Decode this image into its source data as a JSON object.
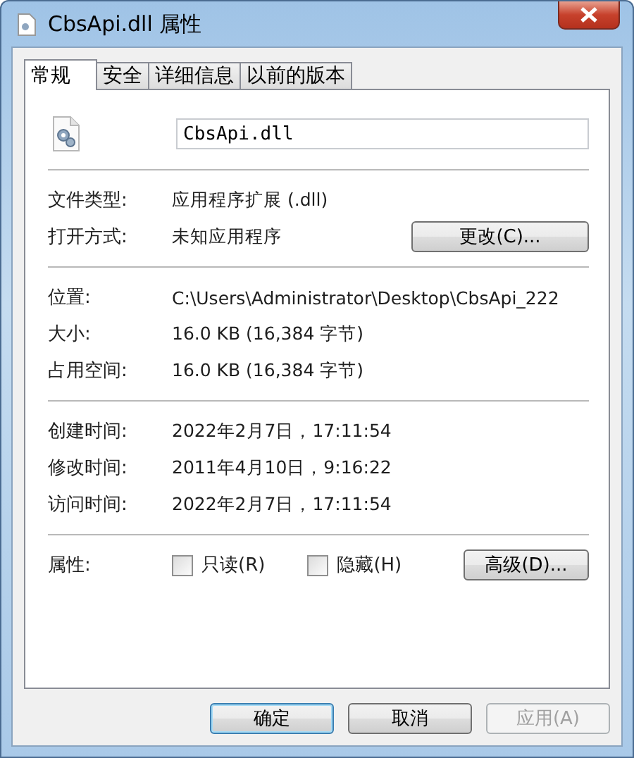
{
  "window": {
    "title": "CbsApi.dll 属性"
  },
  "tabs": [
    {
      "label": "常规",
      "selected": true
    },
    {
      "label": "安全",
      "selected": false
    },
    {
      "label": "详细信息",
      "selected": false
    },
    {
      "label": "以前的版本",
      "selected": false
    }
  ],
  "file_name": "CbsApi.dll",
  "groups": [
    {
      "rows": [
        {
          "label": "文件类型:",
          "value": "应用程序扩展 (.dll)"
        },
        {
          "label": "打开方式:",
          "value": "未知应用程序",
          "button": "更改(C)..."
        }
      ]
    },
    {
      "rows": [
        {
          "label": "位置:",
          "value": "C:\\Users\\Administrator\\Desktop\\CbsApi_222"
        },
        {
          "label": "大小:",
          "value": "16.0 KB (16,384 字节)"
        },
        {
          "label": "占用空间:",
          "value": "16.0 KB (16,384 字节)"
        }
      ]
    },
    {
      "rows": [
        {
          "label": "创建时间:",
          "value": "2022年2月7日，17:11:54"
        },
        {
          "label": "修改时间:",
          "value": "2011年4月10日，9:16:22"
        },
        {
          "label": "访问时间:",
          "value": "2022年2月7日，17:11:54"
        }
      ]
    }
  ],
  "attributes": {
    "label": "属性:",
    "checkboxes": [
      {
        "label": "只读(R)",
        "checked": false
      },
      {
        "label": "隐藏(H)",
        "checked": false
      }
    ],
    "button": "高级(D)..."
  },
  "buttons": [
    {
      "label": "确定",
      "default": true,
      "disabled": false
    },
    {
      "label": "取消",
      "default": false,
      "disabled": false
    },
    {
      "label": "应用(A)",
      "default": false,
      "disabled": true
    }
  ]
}
